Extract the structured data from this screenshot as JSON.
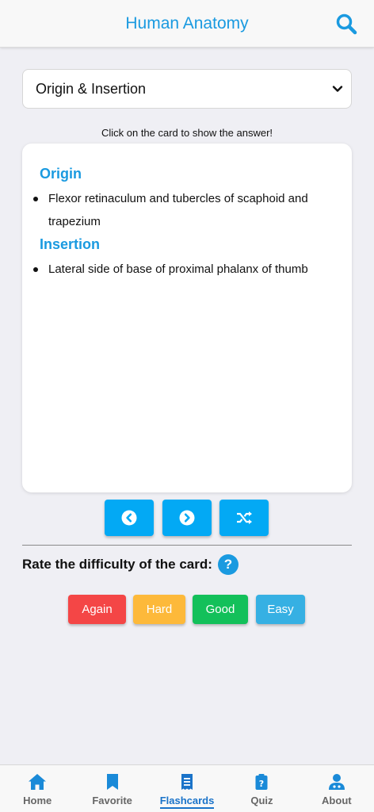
{
  "header": {
    "title": "Human Anatomy",
    "search_icon": "search-icon"
  },
  "topic_select": {
    "value": "Origin & Insertion",
    "icon": "chevron-down-icon"
  },
  "hint": "Click on the card to show the answer!",
  "card": {
    "origin_title": "Origin",
    "origin_items": [
      "Flexor retinaculum and tubercles of scaphoid and trapezium"
    ],
    "insertion_title": "Insertion",
    "insertion_items": [
      "Lateral side of base of proximal phalanx of thumb"
    ]
  },
  "controls": {
    "prev_icon": "chevron-left-circle-icon",
    "next_icon": "chevron-right-circle-icon",
    "shuffle_icon": "shuffle-icon"
  },
  "rating": {
    "label": "Rate the difficulty of the card:",
    "help_symbol": "?",
    "buttons": [
      {
        "label": "Again",
        "color": "#f44646"
      },
      {
        "label": "Hard",
        "color": "#fdb93a"
      },
      {
        "label": "Good",
        "color": "#13c05a"
      },
      {
        "label": "Easy",
        "color": "#36b0e3"
      }
    ]
  },
  "tabs": [
    {
      "label": "Home",
      "icon": "home-icon",
      "active": false
    },
    {
      "label": "Favorite",
      "icon": "bookmark-icon",
      "active": false
    },
    {
      "label": "Flashcards",
      "icon": "flashcards-icon",
      "active": true
    },
    {
      "label": "Quiz",
      "icon": "quiz-icon",
      "active": false
    },
    {
      "label": "About",
      "icon": "user-icon",
      "active": false
    }
  ],
  "colors": {
    "accent": "#1a9ae0",
    "button": "#03a9f4",
    "active_tab": "#1a73c9",
    "background": "#efeff4"
  }
}
